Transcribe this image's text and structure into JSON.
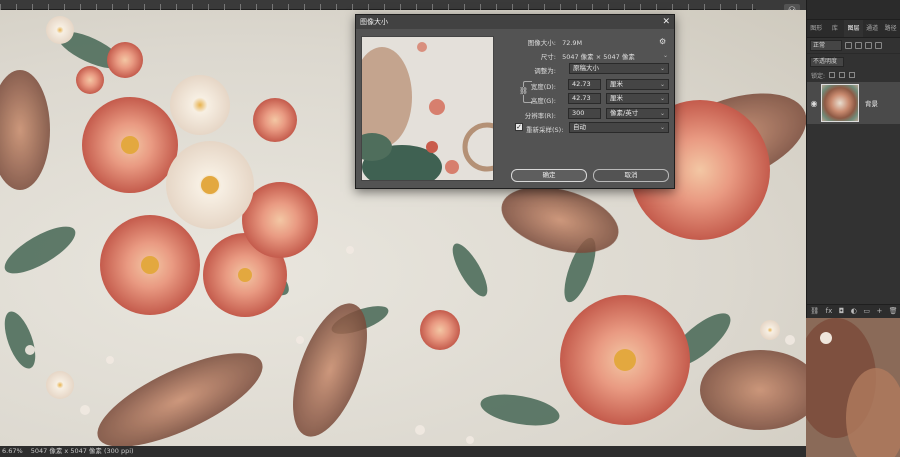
{
  "status_bar": {
    "zoom": "6.67%",
    "doc_info": "5047 像素 x 5047 像素 (300 ppi)"
  },
  "dialog": {
    "title": "图像大小",
    "close_symbol": "✕",
    "image_size_label": "图像大小:",
    "image_size_value": "72.9M",
    "dimensions_label": "尺寸:",
    "dimensions_value": "5047 像素 × 5047 像素",
    "fit_to_label": "调整为:",
    "fit_to_value": "原稿大小",
    "width_label": "宽度(D):",
    "width_value": "42.73",
    "width_unit": "厘米",
    "height_label": "高度(G):",
    "height_value": "42.73",
    "height_unit": "厘米",
    "resolution_label": "分辨率(R):",
    "resolution_value": "300",
    "resolution_unit": "像素/英寸",
    "resample_label": "重新采样(S):",
    "resample_checked": true,
    "resample_value": "自动",
    "ok_label": "确定",
    "cancel_label": "取消"
  },
  "layers_panel": {
    "tabs": [
      "图形",
      "库",
      "图层",
      "通道",
      "路径"
    ],
    "active_tab": 2,
    "filter_label": "正常",
    "blend_label": "不透明度",
    "lock_label": "锁定:",
    "layer_name": "背景"
  },
  "icons": {
    "eye": "eye-icon",
    "gear": "gear-icon",
    "link": "link-icon",
    "user": "user-icon",
    "chevron": "chevron-down-icon"
  },
  "colors": {
    "dialog_bg": "#535353",
    "panel_bg": "#323232",
    "canvas_bg": "#dcd8cf"
  }
}
